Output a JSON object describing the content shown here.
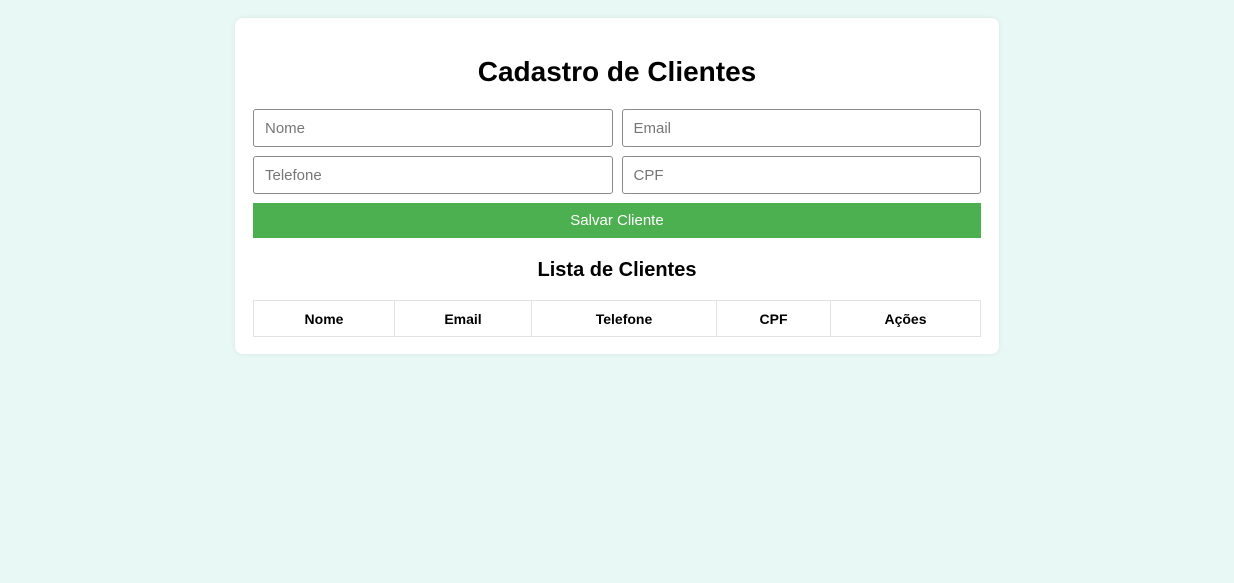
{
  "form": {
    "title": "Cadastro de Clientes",
    "fields": {
      "nome": {
        "placeholder": "Nome",
        "value": ""
      },
      "email": {
        "placeholder": "Email",
        "value": ""
      },
      "telefone": {
        "placeholder": "Telefone",
        "value": ""
      },
      "cpf": {
        "placeholder": "CPF",
        "value": ""
      }
    },
    "save_label": "Salvar Cliente"
  },
  "list": {
    "title": "Lista de Clientes",
    "columns": [
      "Nome",
      "Email",
      "Telefone",
      "CPF",
      "Ações"
    ],
    "rows": []
  },
  "colors": {
    "page_background": "#e8f8f4",
    "card_background": "#ffffff",
    "primary_button": "#4caf50"
  }
}
